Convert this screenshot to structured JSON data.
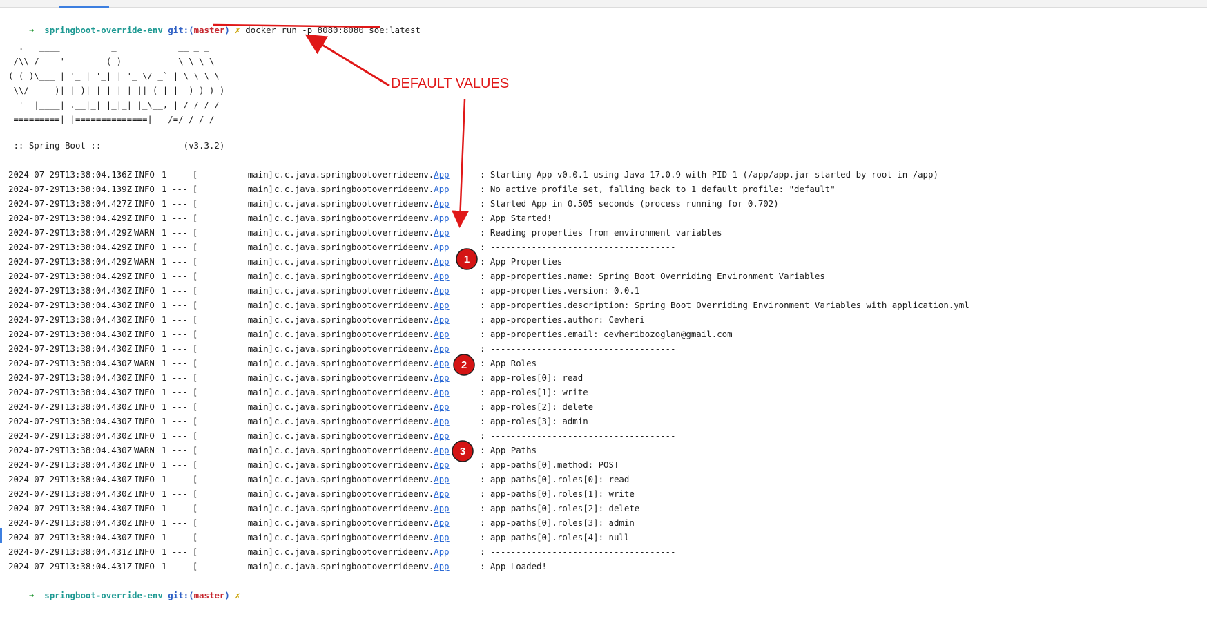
{
  "prompt_top": {
    "arrow": "➜",
    "dir": "springboot-override-env",
    "git_label": "git:(",
    "branch": "master",
    "git_close": ")",
    "dirty": "✗",
    "command": "docker run -p 8080:8080 soe:latest"
  },
  "banner": [
    "  .   ____          _            __ _ _",
    " /\\\\ / ___'_ __ _ _(_)_ __  __ _ \\ \\ \\ \\",
    "( ( )\\___ | '_ | '_| | '_ \\/ _` | \\ \\ \\ \\",
    " \\\\/  ___)| |_)| | | | | || (_| |  ) ) ) )",
    "  '  |____| .__|_| |_|_| |_\\__, | / / / /",
    " =========|_|==============|___/=/_/_/_/"
  ],
  "spring_line": " :: Spring Boot ::                (v3.3.2)",
  "logger_prefix": "c.c.java.springbootoverrideenv.",
  "logger_link": "App",
  "pid": "1 --- [",
  "thread": "main]",
  "logs": [
    {
      "ts": "2024-07-29T13:38:04.136Z",
      "lvl": "INFO",
      "msg": ": Starting App v0.0.1 using Java 17.0.9 with PID 1 (/app/app.jar started by root in /app)"
    },
    {
      "ts": "2024-07-29T13:38:04.139Z",
      "lvl": "INFO",
      "msg": ": No active profile set, falling back to 1 default profile: \"default\""
    },
    {
      "ts": "2024-07-29T13:38:04.427Z",
      "lvl": "INFO",
      "msg": ": Started App in 0.505 seconds (process running for 0.702)"
    },
    {
      "ts": "2024-07-29T13:38:04.429Z",
      "lvl": "INFO",
      "msg": ": App Started!"
    },
    {
      "ts": "2024-07-29T13:38:04.429Z",
      "lvl": "WARN",
      "msg": ": Reading properties from environment variables"
    },
    {
      "ts": "2024-07-29T13:38:04.429Z",
      "lvl": "INFO",
      "msg": ": ------------------------------------"
    },
    {
      "ts": "2024-07-29T13:38:04.429Z",
      "lvl": "WARN",
      "msg": ": App Properties"
    },
    {
      "ts": "2024-07-29T13:38:04.429Z",
      "lvl": "INFO",
      "msg": ": app-properties.name: Spring Boot Overriding Environment Variables"
    },
    {
      "ts": "2024-07-29T13:38:04.430Z",
      "lvl": "INFO",
      "msg": ": app-properties.version: 0.0.1"
    },
    {
      "ts": "2024-07-29T13:38:04.430Z",
      "lvl": "INFO",
      "msg": ": app-properties.description: Spring Boot Overriding Environment Variables with application.yml"
    },
    {
      "ts": "2024-07-29T13:38:04.430Z",
      "lvl": "INFO",
      "msg": ": app-properties.author: Cevheri"
    },
    {
      "ts": "2024-07-29T13:38:04.430Z",
      "lvl": "INFO",
      "msg": ": app-properties.email: cevheribozoglan@gmail.com"
    },
    {
      "ts": "2024-07-29T13:38:04.430Z",
      "lvl": "INFO",
      "msg": ": ------------------------------------"
    },
    {
      "ts": "2024-07-29T13:38:04.430Z",
      "lvl": "WARN",
      "msg": ": App Roles"
    },
    {
      "ts": "2024-07-29T13:38:04.430Z",
      "lvl": "INFO",
      "msg": ": app-roles[0]: read"
    },
    {
      "ts": "2024-07-29T13:38:04.430Z",
      "lvl": "INFO",
      "msg": ": app-roles[1]: write"
    },
    {
      "ts": "2024-07-29T13:38:04.430Z",
      "lvl": "INFO",
      "msg": ": app-roles[2]: delete"
    },
    {
      "ts": "2024-07-29T13:38:04.430Z",
      "lvl": "INFO",
      "msg": ": app-roles[3]: admin"
    },
    {
      "ts": "2024-07-29T13:38:04.430Z",
      "lvl": "INFO",
      "msg": ": ------------------------------------"
    },
    {
      "ts": "2024-07-29T13:38:04.430Z",
      "lvl": "WARN",
      "msg": ": App Paths"
    },
    {
      "ts": "2024-07-29T13:38:04.430Z",
      "lvl": "INFO",
      "msg": ": app-paths[0].method: POST"
    },
    {
      "ts": "2024-07-29T13:38:04.430Z",
      "lvl": "INFO",
      "msg": ": app-paths[0].roles[0]: read"
    },
    {
      "ts": "2024-07-29T13:38:04.430Z",
      "lvl": "INFO",
      "msg": ": app-paths[0].roles[1]: write"
    },
    {
      "ts": "2024-07-29T13:38:04.430Z",
      "lvl": "INFO",
      "msg": ": app-paths[0].roles[2]: delete"
    },
    {
      "ts": "2024-07-29T13:38:04.430Z",
      "lvl": "INFO",
      "msg": ": app-paths[0].roles[3]: admin"
    },
    {
      "ts": "2024-07-29T13:38:04.430Z",
      "lvl": "INFO",
      "msg": ": app-paths[0].roles[4]: null"
    },
    {
      "ts": "2024-07-29T13:38:04.431Z",
      "lvl": "INFO",
      "msg": ": ------------------------------------"
    },
    {
      "ts": "2024-07-29T13:38:04.431Z",
      "lvl": "INFO",
      "msg": ": App Loaded!"
    }
  ],
  "prompt_bottom": {
    "arrow": "➜",
    "dir": "springboot-override-env",
    "git_label": "git:(",
    "branch": "master",
    "git_close": ")",
    "dirty": "✗"
  },
  "annotation": {
    "label": "DEFAULT VALUES",
    "color": "#e01818",
    "badges": [
      "1",
      "2",
      "3"
    ]
  },
  "colors": {
    "prompt_arrow": "#2a9a3a",
    "dir": "#1f9a93",
    "git": "#2d5fc4",
    "branch": "#c6262e",
    "dirty": "#c9a100",
    "link": "#2d6bd6"
  }
}
